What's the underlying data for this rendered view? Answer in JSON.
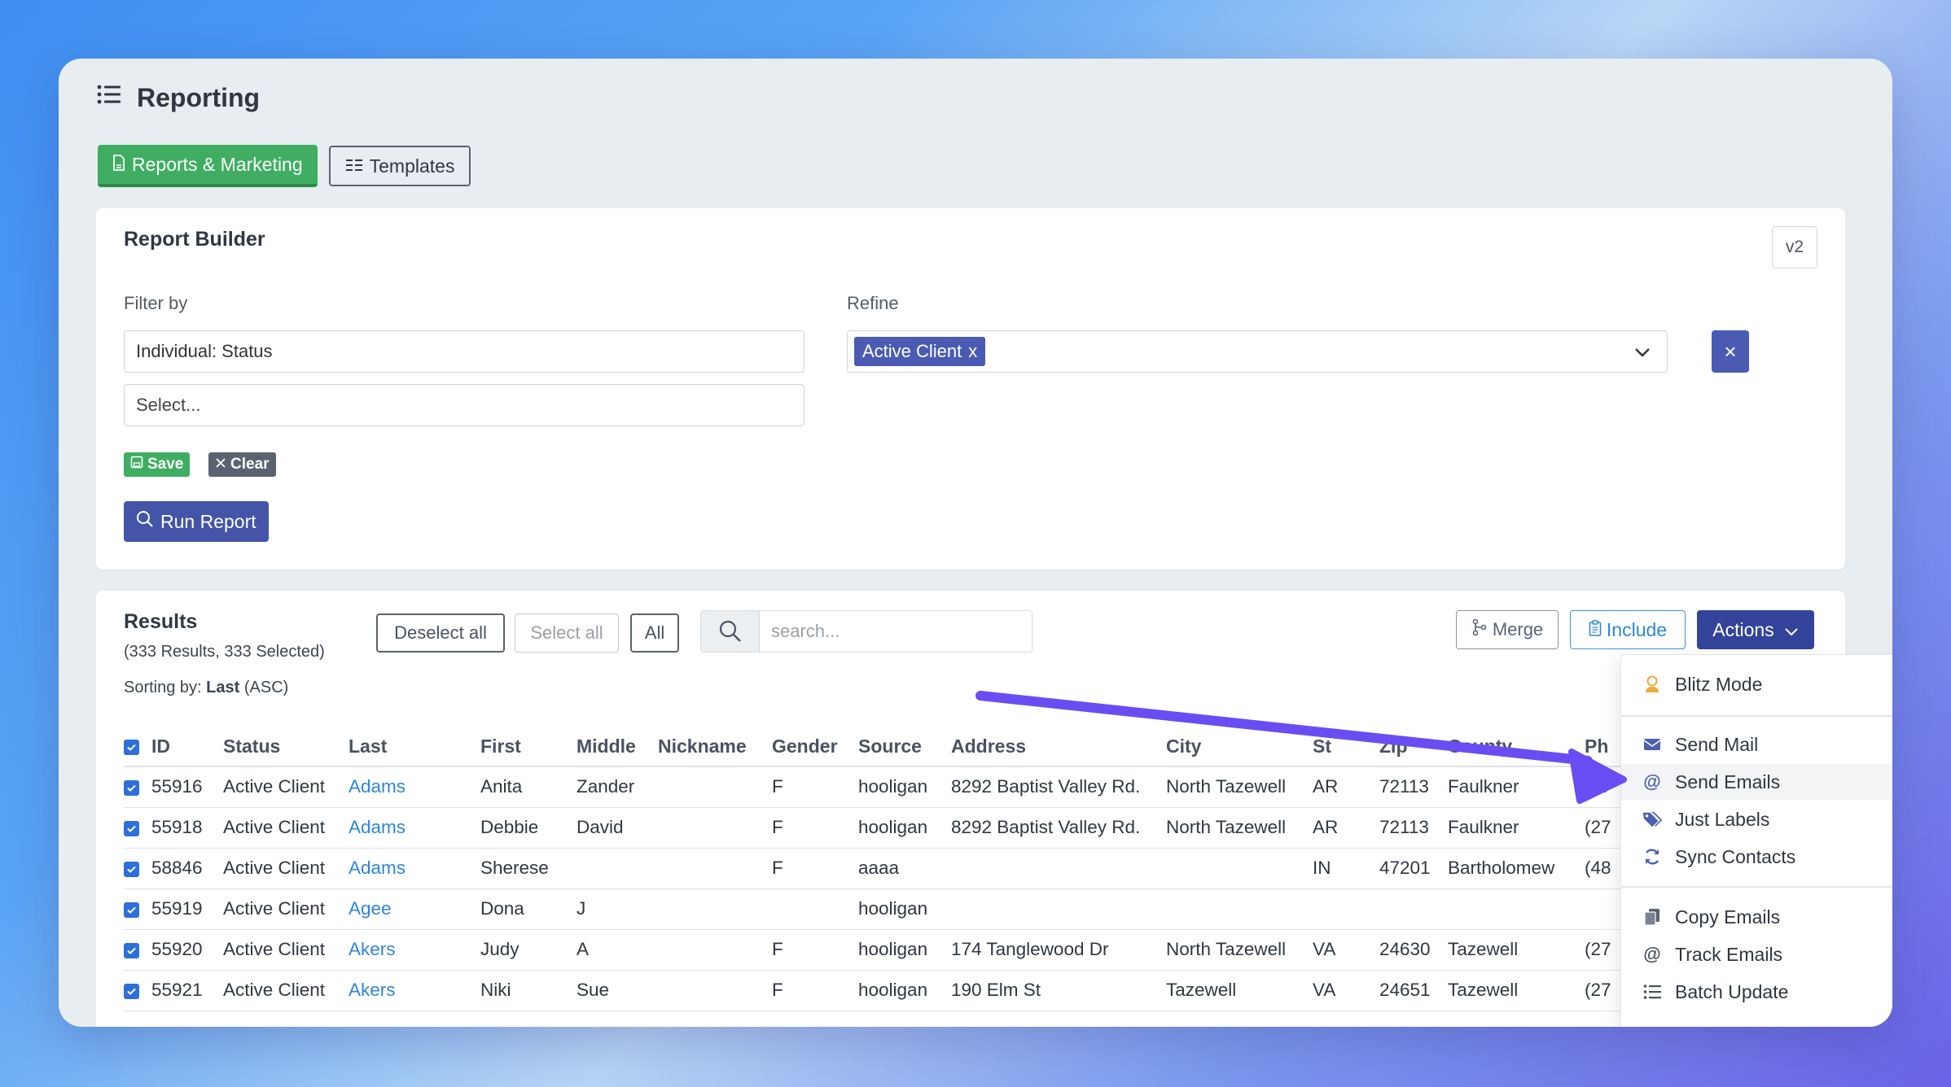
{
  "header": {
    "title": "Reporting"
  },
  "tabs": {
    "reports": "Reports & Marketing",
    "templates": "Templates"
  },
  "builder": {
    "title": "Report Builder",
    "version": "v2",
    "filter_label": "Filter by",
    "filter_value": "Individual: Status",
    "select_placeholder": "Select...",
    "refine_label": "Refine",
    "refine_chip": "Active Client",
    "refine_chip_remove": "x",
    "remove_btn": "×",
    "save": "Save",
    "clear": "Clear",
    "run": "Run Report"
  },
  "results": {
    "title": "Results",
    "count": "(333 Results, 333 Selected)",
    "sorting_prefix": "Sorting by:",
    "sorting_field": "Last",
    "sorting_dir": "(ASC)",
    "deselect_all": "Deselect all",
    "select_all": "Select all",
    "all": "All",
    "search_placeholder": "search...",
    "merge": "Merge",
    "include": "Include",
    "actions": "Actions",
    "columns": [
      "ID",
      "Status",
      "Last",
      "First",
      "Middle",
      "Nickname",
      "Gender",
      "Source",
      "Address",
      "City",
      "St",
      "Zip",
      "County",
      "Ph"
    ],
    "rows": [
      [
        "55916",
        "Active Client",
        "Adams",
        "Anita",
        "Zander",
        "",
        "F",
        "hooligan",
        "8292 Baptist Valley Rd.",
        "North Tazewell",
        "AR",
        "72113",
        "Faulkner",
        "(27"
      ],
      [
        "55918",
        "Active Client",
        "Adams",
        "Debbie",
        "David",
        "",
        "F",
        "hooligan",
        "8292 Baptist Valley Rd.",
        "North Tazewell",
        "AR",
        "72113",
        "Faulkner",
        "(27"
      ],
      [
        "58846",
        "Active Client",
        "Adams",
        "Sherese",
        "",
        "",
        "F",
        "aaaa",
        "",
        "",
        "IN",
        "47201",
        "Bartholomew",
        "(48"
      ],
      [
        "55919",
        "Active Client",
        "Agee",
        "Dona",
        "J",
        "",
        "",
        "hooligan",
        "",
        "",
        "",
        "",
        "",
        ""
      ],
      [
        "55920",
        "Active Client",
        "Akers",
        "Judy",
        "A",
        "",
        "F",
        "hooligan",
        "174 Tanglewood Dr",
        "North Tazewell",
        "VA",
        "24630",
        "Tazewell",
        "(27"
      ],
      [
        "55921",
        "Active Client",
        "Akers",
        "Niki",
        "Sue",
        "",
        "F",
        "hooligan",
        "190 Elm St",
        "Tazewell",
        "VA",
        "24651",
        "Tazewell",
        "(27"
      ]
    ]
  },
  "menu": {
    "blitz": "Blitz Mode",
    "send_mail": "Send Mail",
    "send_emails": "Send Emails",
    "just_labels": "Just Labels",
    "sync_contacts": "Sync Contacts",
    "copy_emails": "Copy Emails",
    "track_emails": "Track Emails",
    "batch_update": "Batch Update"
  },
  "colors": {
    "primary": "#4454a8",
    "success": "#3fae62",
    "link": "#2f86d8",
    "arrow": "#6a4df2"
  }
}
